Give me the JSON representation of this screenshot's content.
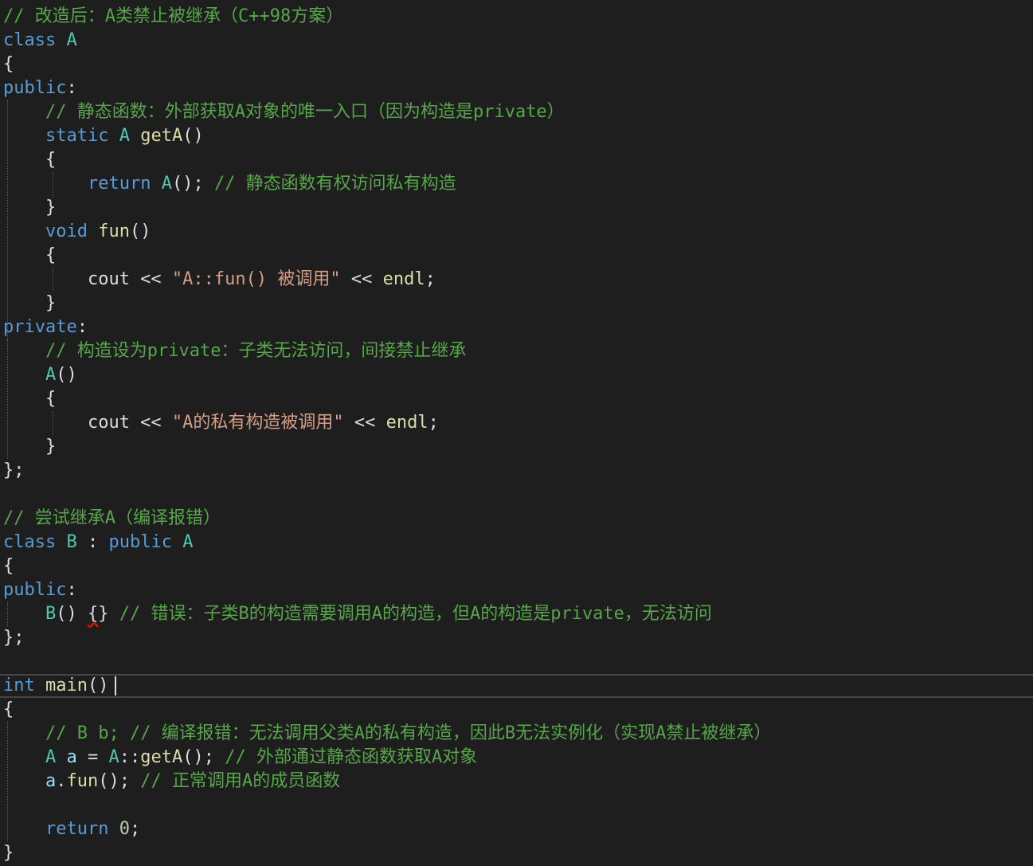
{
  "editor": {
    "lines": [
      [
        [
          "cmt",
          "// 改造后：A类禁止被继承（C++98方案）"
        ]
      ],
      [
        [
          "kw",
          "class"
        ],
        [
          "plain",
          " "
        ],
        [
          "cls",
          "A"
        ]
      ],
      [
        [
          "plain",
          "{"
        ]
      ],
      [
        [
          "kw",
          "public"
        ],
        [
          "plain",
          ":"
        ]
      ],
      [
        [
          "plain",
          "    "
        ],
        [
          "cmt",
          "// 静态函数：外部获取A对象的唯一入口（因为构造是private）"
        ]
      ],
      [
        [
          "plain",
          "    "
        ],
        [
          "kw",
          "static"
        ],
        [
          "plain",
          " "
        ],
        [
          "cls",
          "A"
        ],
        [
          "plain",
          " "
        ],
        [
          "fn",
          "getA"
        ],
        [
          "plain",
          "()"
        ]
      ],
      [
        [
          "plain",
          "    {"
        ]
      ],
      [
        [
          "plain",
          "        "
        ],
        [
          "kw",
          "return"
        ],
        [
          "plain",
          " "
        ],
        [
          "cls",
          "A"
        ],
        [
          "plain",
          "(); "
        ],
        [
          "cmt",
          "// 静态函数有权访问私有构造"
        ]
      ],
      [
        [
          "plain",
          "    }"
        ]
      ],
      [
        [
          "plain",
          "    "
        ],
        [
          "kw",
          "void"
        ],
        [
          "plain",
          " "
        ],
        [
          "fn",
          "fun"
        ],
        [
          "plain",
          "()"
        ]
      ],
      [
        [
          "plain",
          "    {"
        ]
      ],
      [
        [
          "plain",
          "        cout << "
        ],
        [
          "str",
          "\"A::fun() 被调用\""
        ],
        [
          "plain",
          " << "
        ],
        [
          "fn",
          "endl"
        ],
        [
          "plain",
          ";"
        ]
      ],
      [
        [
          "plain",
          "    }"
        ]
      ],
      [
        [
          "kw",
          "private"
        ],
        [
          "plain",
          ":"
        ]
      ],
      [
        [
          "plain",
          "    "
        ],
        [
          "cmt",
          "// 构造设为private：子类无法访问，间接禁止继承"
        ]
      ],
      [
        [
          "plain",
          "    "
        ],
        [
          "cls",
          "A"
        ],
        [
          "plain",
          "()"
        ]
      ],
      [
        [
          "plain",
          "    {"
        ]
      ],
      [
        [
          "plain",
          "        cout << "
        ],
        [
          "str",
          "\"A的私有构造被调用\""
        ],
        [
          "plain",
          " << "
        ],
        [
          "fn",
          "endl"
        ],
        [
          "plain",
          ";"
        ]
      ],
      [
        [
          "plain",
          "    }"
        ]
      ],
      [
        [
          "plain",
          "};"
        ]
      ],
      [],
      [
        [
          "cmt",
          "// 尝试继承A（编译报错）"
        ]
      ],
      [
        [
          "kw",
          "class"
        ],
        [
          "plain",
          " "
        ],
        [
          "cls",
          "B"
        ],
        [
          "plain",
          " : "
        ],
        [
          "kw",
          "public"
        ],
        [
          "plain",
          " "
        ],
        [
          "cls",
          "A"
        ]
      ],
      [
        [
          "plain",
          "{"
        ]
      ],
      [
        [
          "kw",
          "public"
        ],
        [
          "plain",
          ":"
        ]
      ],
      [
        [
          "plain",
          "    "
        ],
        [
          "cls",
          "B"
        ],
        [
          "plain",
          "() "
        ],
        [
          "squiggle",
          "{"
        ],
        [
          "plain",
          "} "
        ],
        [
          "cmt",
          "// 错误：子类B的构造需要调用A的构造，但A的构造是private，无法访问"
        ]
      ],
      [
        [
          "plain",
          "};"
        ]
      ],
      [],
      [
        [
          "kw",
          "int"
        ],
        [
          "plain",
          " "
        ],
        [
          "fn",
          "main"
        ],
        [
          "plain",
          "()"
        ]
      ],
      [
        [
          "plain",
          "{"
        ]
      ],
      [
        [
          "plain",
          "    "
        ],
        [
          "cmt",
          "// B b; // 编译报错：无法调用父类A的私有构造，因此B无法实例化（实现A禁止被继承）"
        ]
      ],
      [
        [
          "plain",
          "    "
        ],
        [
          "cls",
          "A"
        ],
        [
          "plain",
          " "
        ],
        [
          "var",
          "a"
        ],
        [
          "plain",
          " = "
        ],
        [
          "cls",
          "A"
        ],
        [
          "plain",
          "::"
        ],
        [
          "fn",
          "getA"
        ],
        [
          "plain",
          "(); "
        ],
        [
          "cmt",
          "// 外部通过静态函数获取A对象"
        ]
      ],
      [
        [
          "plain",
          "    "
        ],
        [
          "var",
          "a"
        ],
        [
          "plain",
          "."
        ],
        [
          "fn",
          "fun"
        ],
        [
          "plain",
          "(); "
        ],
        [
          "cmt",
          "// 正常调用A的成员函数"
        ]
      ],
      [],
      [
        [
          "plain",
          "    "
        ],
        [
          "kw",
          "return"
        ],
        [
          "plain",
          " "
        ],
        [
          "num",
          "0"
        ],
        [
          "plain",
          ";"
        ]
      ],
      [
        [
          "plain",
          "}"
        ]
      ]
    ],
    "current_line": 29,
    "caret_line": 29
  }
}
